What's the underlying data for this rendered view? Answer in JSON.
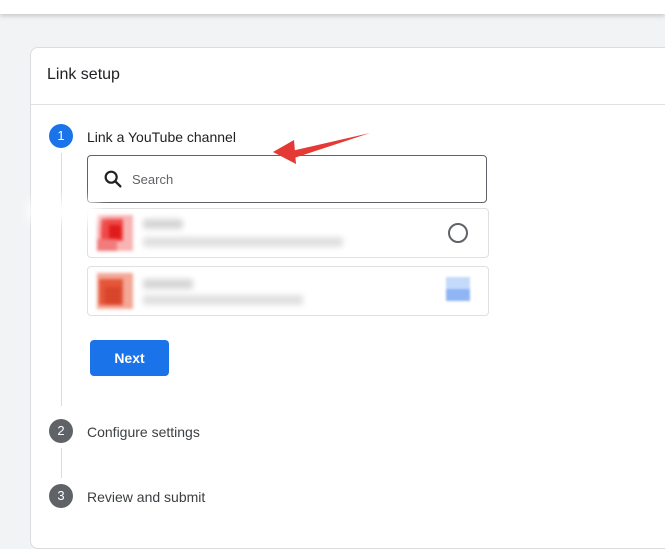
{
  "card": {
    "title": "Link setup"
  },
  "steps": [
    {
      "number": "1",
      "label": "Link a YouTube channel",
      "state": "active"
    },
    {
      "number": "2",
      "label": "Configure settings",
      "state": "inactive"
    },
    {
      "number": "3",
      "label": "Review and submit",
      "state": "inactive"
    }
  ],
  "search": {
    "placeholder": "Search",
    "value": ""
  },
  "channels": [
    {
      "selection": "radio-unselected"
    },
    {
      "selection": "blurred"
    }
  ],
  "next_button": {
    "label": "Next"
  },
  "colors": {
    "primary": "#1a73e8",
    "step_inactive": "#5f6368",
    "annotation_arrow": "#e53935"
  },
  "icons": [
    "search-icon"
  ]
}
